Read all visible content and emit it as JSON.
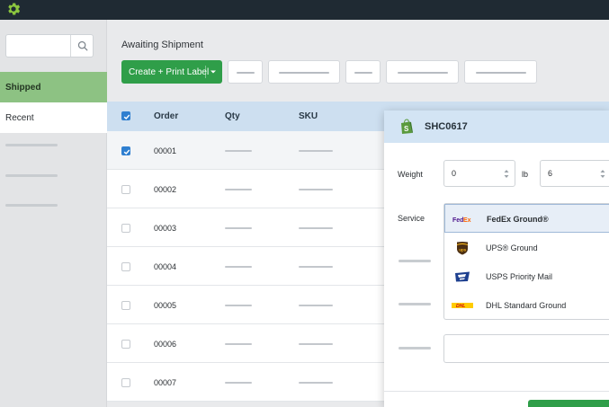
{
  "sidebar": {
    "search": {
      "value": "",
      "placeholder": ""
    },
    "items": [
      {
        "label": "Shipped",
        "active": true
      },
      {
        "label": "Recent"
      }
    ]
  },
  "header": {
    "title": "Awaiting Shipment",
    "primary_button": "Create + Print Label"
  },
  "table": {
    "columns": [
      "Order",
      "Qty",
      "SKU"
    ],
    "rows": [
      {
        "order": "00001",
        "checked": true
      },
      {
        "order": "00002",
        "checked": false
      },
      {
        "order": "00003",
        "checked": false
      },
      {
        "order": "00004",
        "checked": false
      },
      {
        "order": "00005",
        "checked": false
      },
      {
        "order": "00006",
        "checked": false
      },
      {
        "order": "00007",
        "checked": false
      }
    ]
  },
  "panel": {
    "title": "SHC0617",
    "weight_label": "Weight",
    "weight_lb": "0",
    "weight_unit": "lb",
    "weight_oz": "6",
    "service_label": "Service",
    "services": [
      {
        "name": "FedEx Ground®",
        "carrier": "FedEx",
        "selected": true
      },
      {
        "name": "UPS® Ground",
        "carrier": "UPS"
      },
      {
        "name": "USPS Priority Mail",
        "carrier": "USPS"
      },
      {
        "name": "DHL Standard Ground",
        "carrier": "DHL"
      }
    ]
  },
  "icons": {
    "gear": "gear-icon",
    "search": "search-icon",
    "shop": "shopify-icon"
  },
  "colors": {
    "topbar": "#1f2a33",
    "accent_green": "#2f9e49",
    "gear_green": "#8cc63f",
    "shipped_bg": "#8dc283",
    "table_header": "#cddff0",
    "checkbox_blue": "#2f7fd0"
  }
}
